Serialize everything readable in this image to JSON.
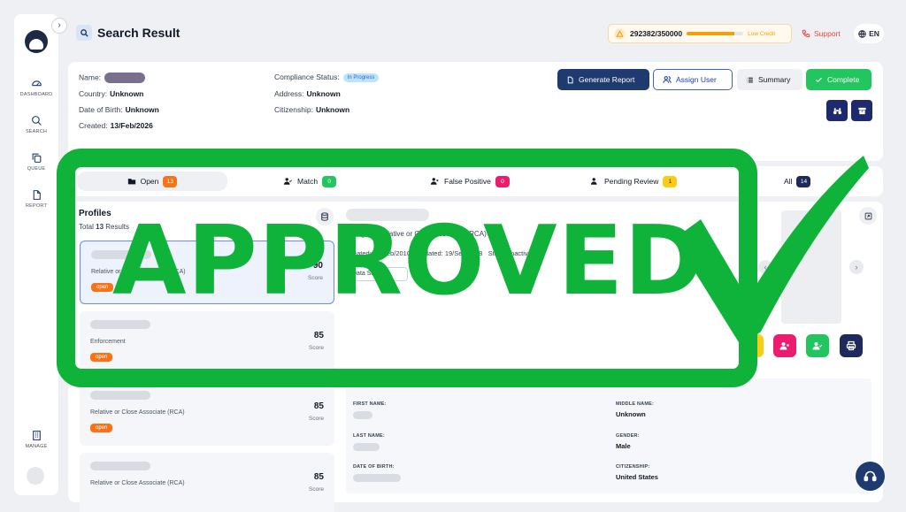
{
  "sidebar": {
    "items": [
      {
        "label": "DASHBOARD",
        "icon": "gauge-icon"
      },
      {
        "label": "SEARCH",
        "icon": "search-icon"
      },
      {
        "label": "QUEUE",
        "icon": "copy-icon"
      },
      {
        "label": "REPORT",
        "icon": "file-icon"
      },
      {
        "label": "MANAGE",
        "icon": "building-icon"
      }
    ]
  },
  "header": {
    "title": "Search Result",
    "credits": {
      "count": "292382/350000",
      "warning": "Low Credit",
      "used_fraction": 0.835
    },
    "support": "Support",
    "language": "EN"
  },
  "info": {
    "name_label": "Name:",
    "country_label": "Country:",
    "country": "Unknown",
    "dob_label": "Date of Birth:",
    "dob": "Unknown",
    "created_label": "Created:",
    "created": "13/Feb/2026",
    "compliance_label": "Compliance Status:",
    "compliance": "In Progress",
    "address_label": "Address:",
    "address": "Unknown",
    "citizenship_label": "Citizenship:",
    "citizenship": "Unknown"
  },
  "actions": {
    "generate": "Generate Report",
    "assign": "Assign User",
    "summary": "Summary",
    "complete": "Complete"
  },
  "tabs": [
    {
      "label": "Open",
      "count": "13"
    },
    {
      "label": "Match",
      "count": "0"
    },
    {
      "label": "False Positive",
      "count": "0"
    },
    {
      "label": "Pending Review",
      "count": "1"
    },
    {
      "label": "All",
      "count": "14"
    }
  ],
  "profiles": {
    "title": "Profiles",
    "total_prefix": "Total",
    "total": "13",
    "total_suffix": "Results",
    "items": [
      {
        "type": "Relative or Close Associate (RCA)",
        "badge": "open",
        "score": "90",
        "score_label": "Score"
      },
      {
        "type": "Enforcement",
        "badge": "open",
        "score": "85",
        "score_label": "Score"
      },
      {
        "type": "Relative or Close Associate (RCA)",
        "badge": "open",
        "score": "85",
        "score_label": "Score"
      },
      {
        "type": "Relative or Close Associate (RCA)",
        "badge": "",
        "score": "85",
        "score_label": "Score"
      }
    ]
  },
  "detail": {
    "category_prefix": "Category:",
    "category": "Relative or Close Associate (RCA)",
    "created_label": "Created:",
    "created": "01/Feb/2010",
    "updated_label": "Updated:",
    "updated": "19/Sep/2018",
    "status": "Status:Inactive",
    "data_source": "Data Sources",
    "fields": {
      "first_name": "FIRST NAME:",
      "middle_name": "MIDDLE NAME:",
      "middle_name_value": "Unknown",
      "last_name": "LAST NAME:",
      "gender": "GENDER:",
      "gender_value": "Male",
      "dob": "DATE OF BIRTH:",
      "citizenship": "CITIZENSHIP:",
      "citizenship_value": "United States"
    }
  },
  "overlay": {
    "stamp": "APPROVED"
  },
  "colors": {
    "primary": "#1e3a6e",
    "success": "#22c55e",
    "stamp": "#0fb33a",
    "open": "#f97316",
    "false_positive": "#ec1c6e",
    "pending": "#facc15"
  }
}
